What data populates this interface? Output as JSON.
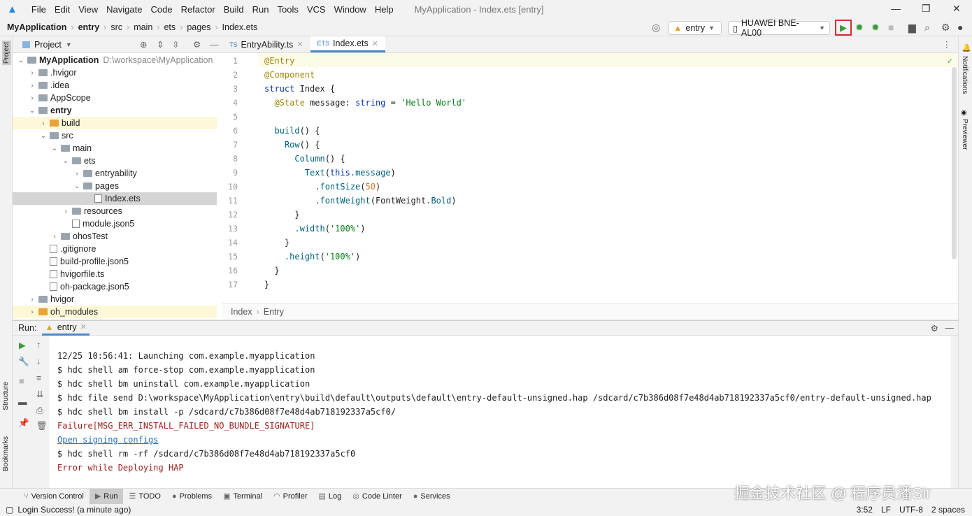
{
  "menu": [
    "File",
    "Edit",
    "View",
    "Navigate",
    "Code",
    "Refactor",
    "Build",
    "Run",
    "Tools",
    "VCS",
    "Window",
    "Help"
  ],
  "window_title": "MyApplication - Index.ets [entry]",
  "breadcrumb": [
    "MyApplication",
    "entry",
    "src",
    "main",
    "ets",
    "pages",
    "Index.ets"
  ],
  "toolbar": {
    "module": "entry",
    "device": "HUAWEI BNE-AL00",
    "run_highlight_color": "#d32f2f"
  },
  "project": {
    "title": "Project",
    "tree": [
      {
        "label": "MyApplication",
        "extra": "D:\\workspace\\MyApplication",
        "depth": 0,
        "open": true,
        "bold": true
      },
      {
        "label": ".hvigor",
        "depth": 1,
        "closed": true
      },
      {
        "label": ".idea",
        "depth": 1,
        "closed": true
      },
      {
        "label": "AppScope",
        "depth": 1,
        "closed": true
      },
      {
        "label": "entry",
        "depth": 1,
        "open": true,
        "bold": true
      },
      {
        "label": "build",
        "depth": 2,
        "closed": true,
        "yellow": true
      },
      {
        "label": "src",
        "depth": 2,
        "open": true
      },
      {
        "label": "main",
        "depth": 3,
        "open": true
      },
      {
        "label": "ets",
        "depth": 4,
        "open": true
      },
      {
        "label": "entryability",
        "depth": 5,
        "closed": true
      },
      {
        "label": "pages",
        "depth": 5,
        "open": true
      },
      {
        "label": "Index.ets",
        "depth": 6,
        "file": true,
        "selected": true
      },
      {
        "label": "resources",
        "depth": 4,
        "closed": true
      },
      {
        "label": "module.json5",
        "depth": 4,
        "file": true
      },
      {
        "label": "ohosTest",
        "depth": 3,
        "closed": true
      },
      {
        "label": ".gitignore",
        "depth": 2,
        "file": true
      },
      {
        "label": "build-profile.json5",
        "depth": 2,
        "file": true
      },
      {
        "label": "hvigorfile.ts",
        "depth": 2,
        "file": true
      },
      {
        "label": "oh-package.json5",
        "depth": 2,
        "file": true
      },
      {
        "label": "hvigor",
        "depth": 1,
        "closed": true
      },
      {
        "label": "oh_modules",
        "depth": 1,
        "closed": true,
        "yellow": true
      }
    ]
  },
  "tabs": [
    "EntryAbility.ts",
    "Index.ets"
  ],
  "code": [
    "@Entry",
    "@Component",
    "struct Index {",
    "  @State message: string = 'Hello World'",
    "",
    "  build() {",
    "    Row() {",
    "      Column() {",
    "        Text(this.message)",
    "          .fontSize(50)",
    "          .fontWeight(FontWeight.Bold)",
    "      }",
    "      .width('100%')",
    "    }",
    "    .height('100%')",
    "  }",
    "}"
  ],
  "editor_breadcrumb": [
    "Index",
    "Entry"
  ],
  "run": {
    "label": "Run:",
    "config": "entry",
    "output": [
      {
        "text": "12/25 10:56:41: Launching com.example.myapplication",
        "type": "normal"
      },
      {
        "text": "$ hdc shell am force-stop com.example.myapplication",
        "type": "normal"
      },
      {
        "text": "$ hdc shell bm uninstall com.example.myapplication",
        "type": "normal"
      },
      {
        "text": "$ hdc file send D:\\workspace\\MyApplication\\entry\\build\\default\\outputs\\default\\entry-default-unsigned.hap /sdcard/c7b386d08f7e48d4ab718192337a5cf0/entry-default-unsigned.hap",
        "type": "normal"
      },
      {
        "text": "$ hdc shell bm install -p /sdcard/c7b386d08f7e48d4ab718192337a5cf0/",
        "type": "normal"
      },
      {
        "text": "Failure[MSG_ERR_INSTALL_FAILED_NO_BUNDLE_SIGNATURE]",
        "type": "error"
      },
      {
        "text": "Open signing configs",
        "type": "link"
      },
      {
        "text": "$ hdc shell rm -rf /sdcard/c7b386d08f7e48d4ab718192337a5cf0",
        "type": "normal"
      },
      {
        "text": "Error while Deploying HAP",
        "type": "error"
      }
    ]
  },
  "bottom_tools": [
    "Version Control",
    "Run",
    "TODO",
    "Problems",
    "Terminal",
    "Profiler",
    "Log",
    "Code Linter",
    "Services"
  ],
  "status": {
    "message": "Login Success! (a minute ago)",
    "position": "3:52",
    "line_sep": "LF",
    "encoding": "UTF-8",
    "indent": "2 spaces"
  },
  "side": {
    "left": [
      "Project",
      "Structure",
      "Bookmarks"
    ],
    "right": [
      "Notifications",
      "Previewer"
    ]
  },
  "watermark": "掘金技术社区 @ 程序员潘Sir"
}
